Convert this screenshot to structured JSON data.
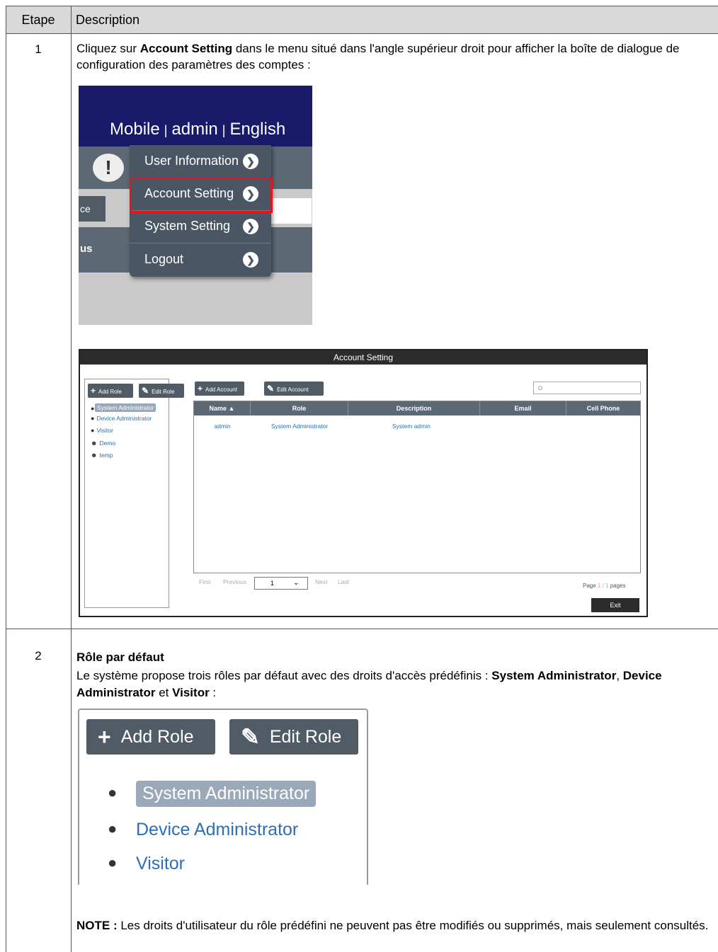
{
  "table": {
    "col_step": "Etape",
    "col_desc": "Description"
  },
  "step1": {
    "number": "1",
    "text_prefix": "Cliquez sur ",
    "text_bold": "Account Setting",
    "text_suffix": " dans le menu situé dans l'angle supérieur droit pour afficher la boîte de dialogue de configuration des paramètres des comptes :"
  },
  "menu_shot": {
    "nav": [
      "Mobile",
      "admin",
      "English"
    ],
    "separator": "|",
    "bubble": "!",
    "left_button_fragment": "ce",
    "left_header_fragment": "us",
    "items": [
      "User Information",
      "Account Setting",
      "System Setting",
      "Logout"
    ],
    "highlighted_item": "Account Setting",
    "highlight_color": "#e2151b"
  },
  "dialog": {
    "title": "Account Setting",
    "add_role": "Add Role",
    "edit_role": "Edit Role",
    "add_account": "Add Account",
    "edit_account": "Edit Account",
    "roles": [
      "System Administrator",
      "Device Administrator",
      "Visitor",
      "Demo",
      "temp"
    ],
    "columns": [
      "Name ▲",
      "Role",
      "Description",
      "Email",
      "Cell Phone"
    ],
    "rows": [
      [
        "admin",
        "System Administrator",
        "System admin",
        "",
        ""
      ]
    ],
    "pager": {
      "first": "First",
      "previous": "Previous",
      "page": "1",
      "next": "Next",
      "last": "Last"
    },
    "page_info": {
      "prefix": "Page ",
      "current": "1",
      "sep": " / ",
      "total": "1",
      "suffix": " pages"
    },
    "exit": "Exit"
  },
  "step2": {
    "number": "2",
    "heading": "Rôle par défaut",
    "text_prefix": "Le système propose trois rôles par défaut avec des droits d'accès prédéfinis : ",
    "role1": "System Administrator",
    "sep1": ", ",
    "role2": "Device Administrator",
    "sep2": " et ",
    "role3": "Visitor",
    "text_suffix": " :",
    "note_label": "NOTE : ",
    "note_text": "Les droits d'utilisateur du rôle prédéfini ne peuvent pas être modifiés ou supprimés, mais seulement consultés."
  },
  "roles_shot": {
    "add_role": "Add Role",
    "edit_role": "Edit Role",
    "roles": [
      "System Administrator",
      "Device Administrator",
      "Visitor"
    ]
  }
}
